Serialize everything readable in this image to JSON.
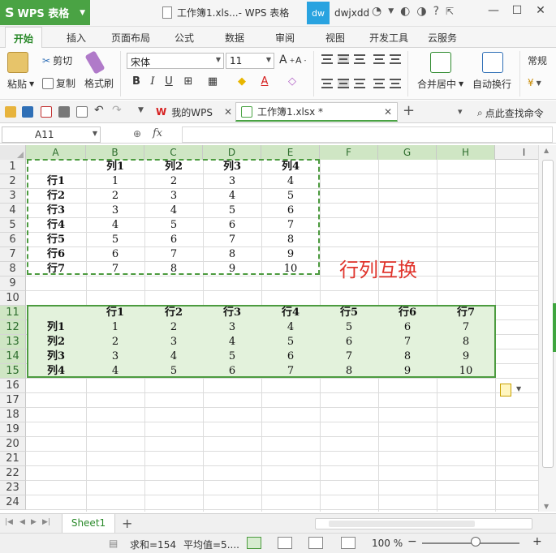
{
  "titlebar": {
    "app_name": "WPS 表格",
    "doc_title": "工作簿1.xls...- WPS 表格",
    "avatar_text": "dw",
    "user_name": "dwjxdd"
  },
  "menu_tabs": [
    "开始",
    "插入",
    "页面布局",
    "公式",
    "数据",
    "审阅",
    "视图",
    "开发工具",
    "云服务"
  ],
  "ribbon": {
    "paste": "粘贴",
    "cut": "剪切",
    "copy": "复制",
    "format_painter": "格式刷",
    "font_name": "宋体",
    "font_size": "11",
    "merge_center": "合并居中",
    "wrap_text": "自动换行",
    "number_format": "常规"
  },
  "doc_tabs": {
    "wps_tab": "我的WPS",
    "file_tab": "工作簿1.xlsx *",
    "find_command": "点此查找命令"
  },
  "formula_bar": {
    "name_box": "A11",
    "fx": "fx",
    "formula": ""
  },
  "sheet": {
    "columns": [
      "A",
      "B",
      "C",
      "D",
      "E",
      "F",
      "G",
      "H",
      "I"
    ],
    "rows": [
      "1",
      "2",
      "3",
      "4",
      "5",
      "6",
      "7",
      "8",
      "9",
      "10",
      "11",
      "12",
      "13",
      "14",
      "15",
      "16",
      "17",
      "18",
      "19",
      "20",
      "21",
      "22",
      "23",
      "24"
    ],
    "table1": {
      "header": [
        "",
        "列1",
        "列2",
        "列3",
        "列4"
      ],
      "rows": [
        [
          "行1",
          "1",
          "2",
          "3",
          "4"
        ],
        [
          "行2",
          "2",
          "3",
          "4",
          "5"
        ],
        [
          "行3",
          "3",
          "4",
          "5",
          "6"
        ],
        [
          "行4",
          "4",
          "5",
          "6",
          "7"
        ],
        [
          "行5",
          "5",
          "6",
          "7",
          "8"
        ],
        [
          "行6",
          "6",
          "7",
          "8",
          "9"
        ],
        [
          "行7",
          "7",
          "8",
          "9",
          "10"
        ]
      ]
    },
    "table2": {
      "header": [
        "",
        "行1",
        "行2",
        "行3",
        "行4",
        "行5",
        "行6",
        "行7"
      ],
      "rows": [
        [
          "列1",
          "1",
          "2",
          "3",
          "4",
          "5",
          "6",
          "7"
        ],
        [
          "列2",
          "2",
          "3",
          "4",
          "5",
          "6",
          "7",
          "8"
        ],
        [
          "列3",
          "3",
          "4",
          "5",
          "6",
          "7",
          "8",
          "9"
        ],
        [
          "列4",
          "4",
          "5",
          "6",
          "7",
          "8",
          "9",
          "10"
        ]
      ]
    },
    "annotation": "行列互换",
    "accent_color": "#4c9b3f",
    "annotation_color": "#e0342c"
  },
  "sheet_tabs": {
    "active": "Sheet1"
  },
  "statusbar": {
    "sum": "求和=154",
    "average": "平均值=5....",
    "zoom": "100 %"
  }
}
